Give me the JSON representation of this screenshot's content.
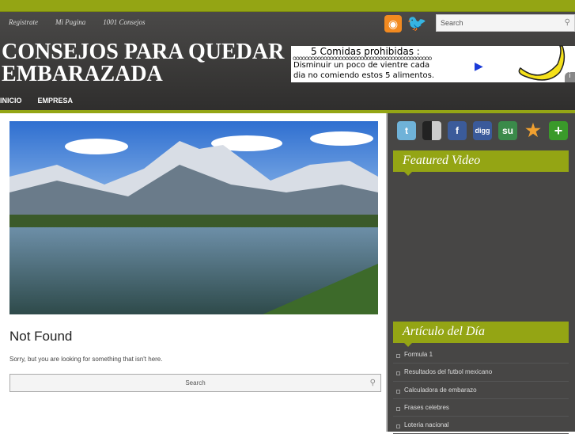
{
  "top_links": [
    "Registrate",
    "Mi Pagina",
    "1001 Consejos"
  ],
  "search_top": {
    "placeholder": "Search"
  },
  "site_title": "CONSEJOS PARA QUEDAR EMBARAZADA",
  "ad": {
    "heading": "5 Comidas prohibidas :",
    "line1": "Disminuir un poco de vientre cada",
    "line2": "dia no comiendo estos 5 alimentos."
  },
  "nav": [
    "INICIO",
    "EMPRESA"
  ],
  "main": {
    "heading": "Not Found",
    "message": "Sorry, but you are looking for something that isn't here.",
    "search_placeholder": "Search"
  },
  "sidebar": {
    "featured_title": "Featured Video",
    "article_title": "Artículo del Día",
    "articles": [
      "Formula 1",
      "Resultados del futbol mexicano",
      "Calculadora de embarazo",
      "Frases celebres",
      "Loteria nacional"
    ]
  }
}
